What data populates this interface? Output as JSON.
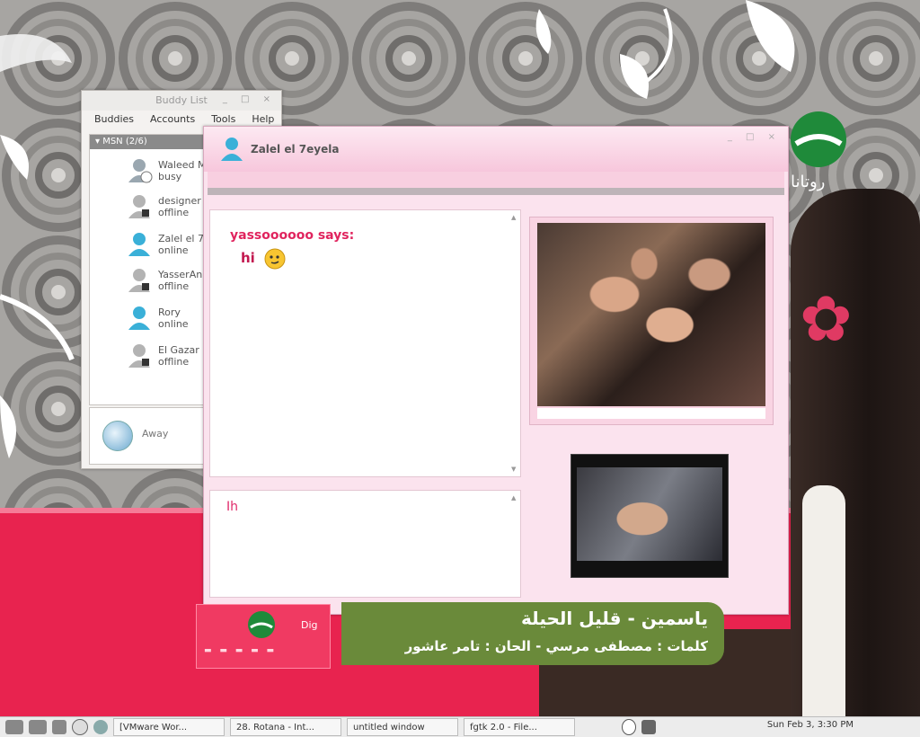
{
  "buddy_list": {
    "title": "Buddy List",
    "menu": [
      "Buddies",
      "Accounts",
      "Tools",
      "Help"
    ],
    "group": "MSN (2/6)",
    "buddies": [
      {
        "name": "Waleed M",
        "status": "busy"
      },
      {
        "name": "designer",
        "status": "offline"
      },
      {
        "name": "Zalel el 7",
        "status": "online"
      },
      {
        "name": "YasserAn",
        "status": "offline"
      },
      {
        "name": "Rory",
        "status": "online"
      },
      {
        "name": "El Gazar",
        "status": "offline"
      }
    ],
    "status_label": "Away"
  },
  "chat": {
    "title": "Zalel el 7eyela",
    "sender_line": "yassoooooo says:",
    "message": "hi",
    "input_text": "Ih"
  },
  "tv": {
    "channel": "روتانا",
    "lyric_title": "ياسمين -  قليل الحيلة",
    "lyric_credits": "كلمات : مصطفى مرسي  - الحان : تامر عاشور",
    "dig_label": "Dig"
  },
  "taskbar": {
    "tasks": [
      "[VMware Wor...",
      "28. Rotana - Int...",
      "untitled window",
      "fgtk 2.0 - File..."
    ],
    "clock": "Sun Feb  3,  3:30 PM"
  },
  "colors": {
    "pink_band": "#e8234f",
    "chat_accent": "#e0245e",
    "lyric_banner": "#6a8a3a"
  }
}
